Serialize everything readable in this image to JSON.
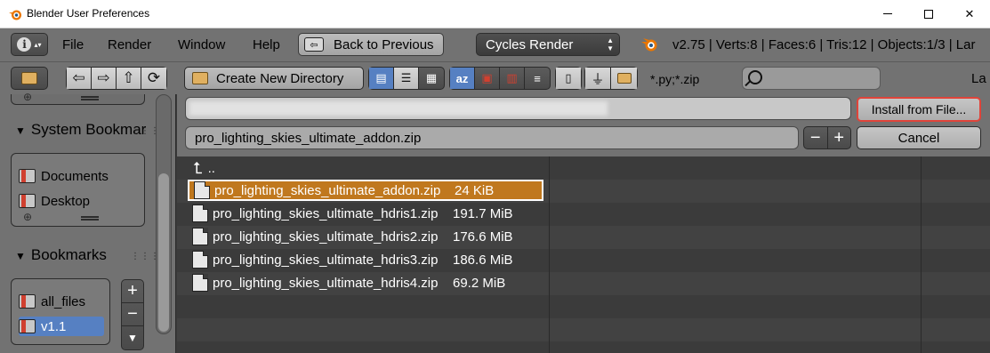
{
  "window": {
    "title": "Blender User Preferences",
    "minimize": "",
    "maximize": "",
    "close": "✕"
  },
  "menu": {
    "items": [
      "File",
      "Render",
      "Window",
      "Help"
    ],
    "back_label": "Back to Previous",
    "render_engine": "Cycles Render",
    "stats": "v2.75 | Verts:8 | Faces:6 | Tris:12 | Objects:1/3 | Lar"
  },
  "filebrowser": {
    "create_dir_label": "Create New Directory",
    "filter_text": "*.py;*.zip",
    "search_placeholder": "",
    "path_value": "",
    "filename": "pro_lighting_skies_ultimate_addon.zip",
    "install_label": "Install from File...",
    "cancel_label": "Cancel",
    "parent_label": ".."
  },
  "sidebar": {
    "system_bookmarks_title": "System Bookmar",
    "system_items": [
      "Documents",
      "Desktop"
    ],
    "bookmarks_title": "Bookmarks",
    "bookmark_items": [
      "all_files",
      "v1.1"
    ],
    "selected_bookmark": "v1.1"
  },
  "files": [
    {
      "name": "pro_lighting_skies_ultimate_addon.zip",
      "size": "24 KiB",
      "selected": true
    },
    {
      "name": "pro_lighting_skies_ultimate_hdris1.zip",
      "size": "191.7 MiB",
      "selected": false
    },
    {
      "name": "pro_lighting_skies_ultimate_hdris2.zip",
      "size": "176.6 MiB",
      "selected": false
    },
    {
      "name": "pro_lighting_skies_ultimate_hdris3.zip",
      "size": "186.6 MiB",
      "selected": false
    },
    {
      "name": "pro_lighting_skies_ultimate_hdris4.zip",
      "size": "69.2 MiB",
      "selected": false
    }
  ],
  "colors": {
    "selection": "#c0781e",
    "active_toggle": "#5680c2",
    "highlight_border": "#e0443a"
  },
  "icons": [
    "blender-logo-icon",
    "info-icon",
    "back-icon",
    "folder-icon",
    "search-icon",
    "file-icon",
    "bookmark-icon",
    "parent-dir-icon"
  ]
}
